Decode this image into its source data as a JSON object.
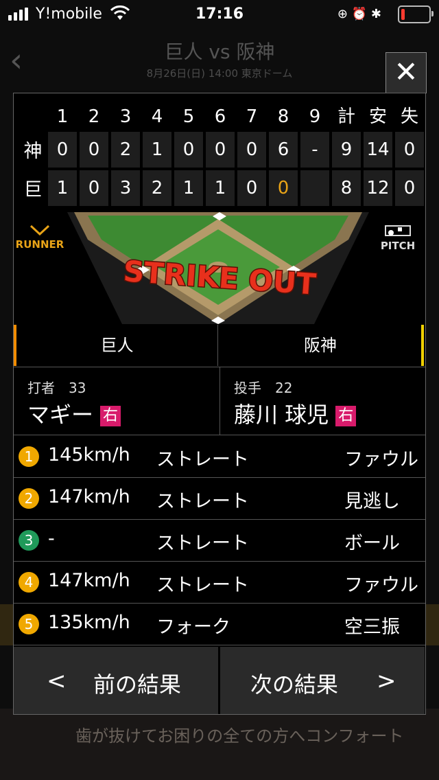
{
  "status_bar": {
    "carrier": "Y!mobile",
    "time": "17:16",
    "battery_level": 0.15
  },
  "header": {
    "title": "巨人 vs 阪神",
    "subtitle": "8月26日(日) 14:00 東京ドーム"
  },
  "ad": {
    "text": "歯が抜けてお困りの全ての方へコンフォート"
  },
  "scoreboard": {
    "columns": [
      "1",
      "2",
      "3",
      "4",
      "5",
      "6",
      "7",
      "8",
      "9",
      "計",
      "安",
      "失"
    ],
    "rows": [
      {
        "team": "神",
        "scores": [
          "0",
          "0",
          "2",
          "1",
          "0",
          "0",
          "0",
          "6",
          "-",
          "9",
          "14",
          "0"
        ]
      },
      {
        "team": "巨",
        "scores": [
          "1",
          "0",
          "3",
          "2",
          "1",
          "1",
          "0",
          "0",
          "",
          "8",
          "12",
          "0"
        ]
      }
    ],
    "current_inning_highlight": "#e8a317"
  },
  "field": {
    "runner_label": "RUNNER",
    "pitch_label": "PITCH",
    "event_text": "STRIKE OUT"
  },
  "teams": {
    "left": "巨人",
    "right": "阪神",
    "left_color": "#f28c00",
    "right_color": "#f0d000"
  },
  "batter": {
    "role": "打者　33",
    "name": "マギー",
    "hand": "右"
  },
  "pitcher": {
    "role": "投手　22",
    "name": "藤川 球児",
    "hand": "右"
  },
  "pitches": [
    {
      "num": "1",
      "speed": "145km/h",
      "type": "ストレート",
      "result": "ファウル",
      "color": "#f0a800"
    },
    {
      "num": "2",
      "speed": "147km/h",
      "type": "ストレート",
      "result": "見逃し",
      "color": "#f0a800"
    },
    {
      "num": "3",
      "speed": "-",
      "type": "ストレート",
      "result": "ボール",
      "color": "#1f9a5a"
    },
    {
      "num": "4",
      "speed": "147km/h",
      "type": "ストレート",
      "result": "ファウル",
      "color": "#f0a800"
    },
    {
      "num": "5",
      "speed": "135km/h",
      "type": "フォーク",
      "result": "空三振",
      "color": "#f0a800"
    }
  ],
  "nav": {
    "prev_arrow": "<",
    "prev_label": "前の結果",
    "next_label": "次の結果",
    "next_arrow": ">"
  }
}
